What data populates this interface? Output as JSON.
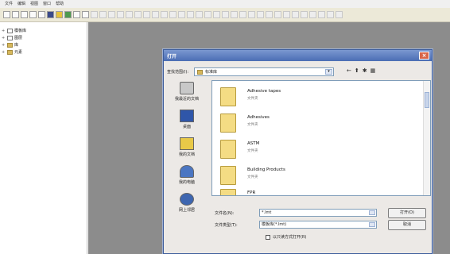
{
  "menubar": {
    "items": [
      "文件",
      "编辑",
      "视图",
      "窗口",
      "帮助"
    ]
  },
  "tree": {
    "items": [
      {
        "label": "模板库"
      },
      {
        "label": "图层"
      },
      {
        "label": "库"
      },
      {
        "label": "元素"
      }
    ]
  },
  "dialog": {
    "title": "打开",
    "lookin_label": "查找范围(I):",
    "lookin_value": "标准库",
    "places": [
      {
        "label": "我最近的文档",
        "icon": "recent-icon"
      },
      {
        "label": "桌面",
        "icon": "desktop-icon"
      },
      {
        "label": "我的文档",
        "icon": "documents-icon"
      },
      {
        "label": "我的电脑",
        "icon": "computer-icon"
      },
      {
        "label": "网上邻居",
        "icon": "network-icon"
      }
    ],
    "files": [
      {
        "name": "Adhesive tapes",
        "type": "文件夹"
      },
      {
        "name": "Adhesives",
        "type": "文件夹"
      },
      {
        "name": "ASTM",
        "type": "文件夹"
      },
      {
        "name": "Building Products",
        "type": "文件夹"
      },
      {
        "name": "FPR",
        "type": ""
      }
    ],
    "filename_label": "文件名(N):",
    "filename_value": "*.lmt",
    "filetype_label": "文件类型(T):",
    "filetype_value": "模板库(*.lmt)",
    "readonly_label": "以只读方式打开(R)",
    "open_button": "打开(O)",
    "cancel_button": "取消"
  }
}
